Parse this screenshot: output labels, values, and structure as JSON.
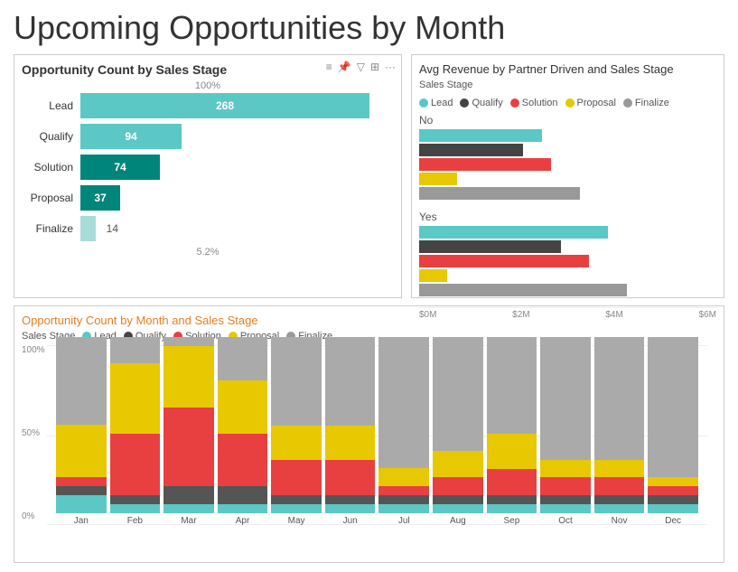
{
  "title": "Upcoming Opportunities by Month",
  "left_panel": {
    "title": "Opportunity Count by Sales Stage",
    "percent_top": "100%",
    "percent_bottom": "5.2%",
    "bars": [
      {
        "label": "Lead",
        "value": 268,
        "pct": 100,
        "color": "#5bc8c5",
        "show_value": true
      },
      {
        "label": "Qualify",
        "value": 94,
        "pct": 35,
        "color": "#5bc8c5",
        "show_value": true
      },
      {
        "label": "Solution",
        "value": 74,
        "pct": 27.6,
        "color": "#00857a",
        "show_value": true
      },
      {
        "label": "Proposal",
        "value": 37,
        "pct": 13.8,
        "color": "#00857a",
        "show_value": true
      },
      {
        "label": "Finalize",
        "value": 14,
        "pct": 5.2,
        "color": "#a8dcd9",
        "show_value": false
      }
    ]
  },
  "right_panel": {
    "title": "Avg Revenue by Partner Driven and Sales Stage",
    "legend_label": "Sales Stage",
    "legend_items": [
      {
        "label": "Lead",
        "color": "#5bc8c5"
      },
      {
        "label": "Qualify",
        "color": "#444"
      },
      {
        "label": "Solution",
        "color": "#e84040"
      },
      {
        "label": "Proposal",
        "color": "#e8c800"
      },
      {
        "label": "Finalize",
        "color": "#999"
      }
    ],
    "groups": [
      {
        "label": "No",
        "bars": [
          {
            "color": "#5bc8c5",
            "pct": 65
          },
          {
            "color": "#444",
            "pct": 55
          },
          {
            "color": "#e84040",
            "pct": 70
          },
          {
            "color": "#e8c800",
            "pct": 20
          },
          {
            "color": "#999",
            "pct": 85
          }
        ]
      },
      {
        "label": "Yes",
        "bars": [
          {
            "color": "#5bc8c5",
            "pct": 100
          },
          {
            "color": "#444",
            "pct": 75
          },
          {
            "color": "#e84040",
            "pct": 90
          },
          {
            "color": "#e8c800",
            "pct": 15
          },
          {
            "color": "#999",
            "pct": 110
          }
        ]
      }
    ],
    "x_axis": [
      "$0M",
      "$2M",
      "$4M",
      "$6M"
    ]
  },
  "bottom_panel": {
    "title": "Opportunity Count by Month and Sales Stage",
    "legend_label": "Sales Stage",
    "legend_items": [
      {
        "label": "Lead",
        "color": "#5bc8c5"
      },
      {
        "label": "Qualify",
        "color": "#444"
      },
      {
        "label": "Solution",
        "color": "#e84040"
      },
      {
        "label": "Proposal",
        "color": "#e8c800"
      },
      {
        "label": "Finalize",
        "color": "#999"
      }
    ],
    "y_labels": [
      "100%",
      "50%",
      "0%"
    ],
    "months": [
      "Jan",
      "Feb",
      "Mar",
      "Apr",
      "May",
      "Jun",
      "Jul",
      "Aug",
      "Sep",
      "Oct",
      "Nov",
      "Dec"
    ],
    "data": {
      "Jan": {
        "lead": 10,
        "qualify": 5,
        "solution": 5,
        "proposal": 30,
        "finalize": 50
      },
      "Feb": {
        "lead": 5,
        "qualify": 5,
        "solution": 35,
        "proposal": 40,
        "finalize": 15
      },
      "Mar": {
        "lead": 5,
        "qualify": 10,
        "solution": 45,
        "proposal": 35,
        "finalize": 5
      },
      "Apr": {
        "lead": 5,
        "qualify": 10,
        "solution": 30,
        "proposal": 30,
        "finalize": 25
      },
      "May": {
        "lead": 5,
        "qualify": 5,
        "solution": 20,
        "proposal": 20,
        "finalize": 50
      },
      "Jun": {
        "lead": 5,
        "qualify": 5,
        "solution": 20,
        "proposal": 20,
        "finalize": 50
      },
      "Jul": {
        "lead": 5,
        "qualify": 5,
        "solution": 5,
        "proposal": 10,
        "finalize": 75
      },
      "Aug": {
        "lead": 5,
        "qualify": 5,
        "solution": 10,
        "proposal": 15,
        "finalize": 65
      },
      "Sep": {
        "lead": 5,
        "qualify": 5,
        "solution": 15,
        "proposal": 20,
        "finalize": 55
      },
      "Oct": {
        "lead": 5,
        "qualify": 5,
        "solution": 10,
        "proposal": 10,
        "finalize": 70
      },
      "Nov": {
        "lead": 5,
        "qualify": 5,
        "solution": 10,
        "proposal": 10,
        "finalize": 70
      },
      "Dec": {
        "lead": 5,
        "qualify": 5,
        "solution": 5,
        "proposal": 5,
        "finalize": 80
      }
    }
  },
  "colors": {
    "lead": "#5bc8c5",
    "qualify": "#555555",
    "solution": "#e84040",
    "proposal": "#e8c800",
    "finalize": "#aaaaaa"
  }
}
